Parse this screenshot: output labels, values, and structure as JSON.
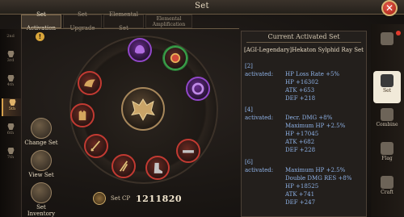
{
  "window": {
    "title": "Set",
    "close_icon": "✕"
  },
  "tabs": [
    {
      "label": "Set Activation",
      "active": true
    },
    {
      "label": "Set Upgrade",
      "active": false
    },
    {
      "label": "Elemental Set",
      "active": false
    },
    {
      "label_line1": "Elemental",
      "label_line2": "Amplification",
      "active": false
    }
  ],
  "levels": [
    {
      "label": "2nd"
    },
    {
      "label": "3rd"
    },
    {
      "label": "4th"
    },
    {
      "label": "5th",
      "active": true
    },
    {
      "label": "6th"
    },
    {
      "label": "7th"
    }
  ],
  "side_buttons": {
    "change_set": "Change Set",
    "view_set": "View Set",
    "set_inventory": "Set Inventory"
  },
  "set_cp": {
    "label": "Set CP",
    "value": "1211820"
  },
  "panel": {
    "heading": "Current Activated Set",
    "set_name": "[AGI-Legendary]Hekaton Sylphid Ray Set",
    "bonuses": [
      {
        "pieces": "[2]",
        "label": "activated:",
        "stats": [
          "HP Loss Rate +5%",
          "HP +16302",
          "ATK +653",
          "DEF +218"
        ]
      },
      {
        "pieces": "[4]",
        "label": "activated:",
        "stats": [
          "Decr. DMG +8%",
          "Maximum HP +2.5%",
          "HP +17045",
          "ATK +682",
          "DEF +228"
        ]
      },
      {
        "pieces": "[6]",
        "label": "activated:",
        "stats": [
          "Maximum HP +2.5%",
          "Double DMG RES +8%",
          "HP +18525",
          "ATK +741",
          "DEF +247"
        ]
      }
    ]
  },
  "right_nav": [
    {
      "label": "",
      "badge": true
    },
    {
      "label": "Set",
      "active": true
    },
    {
      "label": "Combine"
    },
    {
      "label": "Flag"
    },
    {
      "label": "Craft"
    }
  ],
  "colors": {
    "accent_gold": "#d7a24c",
    "stat_blue": "#8fb3e8",
    "slot_red": "#c23a32",
    "slot_purple": "#9147c9",
    "slot_green": "#3aa04a"
  }
}
